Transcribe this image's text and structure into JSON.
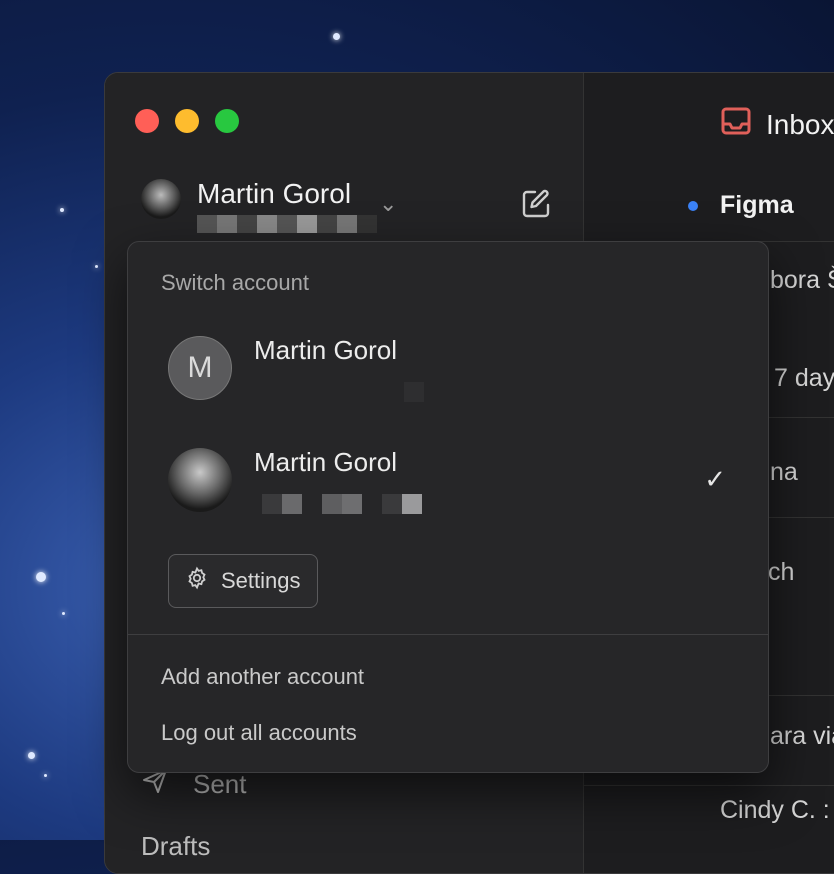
{
  "window": {
    "controls": [
      "close",
      "minimize",
      "zoom"
    ]
  },
  "sidebar": {
    "account_name": "Martin Gorol",
    "nav": [
      {
        "label": "Sent",
        "icon": "paper-plane-icon"
      },
      {
        "label": "Drafts",
        "icon": "drafts-icon"
      }
    ]
  },
  "mail_list": {
    "title": "Inbox",
    "rows": [
      {
        "sender": "Figma",
        "unread": true
      },
      {
        "sender": "bora Š"
      },
      {
        "sender": "7 day"
      },
      {
        "sender": "na"
      },
      {
        "sender": "ch"
      },
      {
        "sender": "ara via"
      },
      {
        "sender": "Cindy C. :"
      }
    ]
  },
  "switcher": {
    "title": "Switch account",
    "accounts": [
      {
        "name": "Martin Gorol",
        "initial": "M",
        "selected": false
      },
      {
        "name": "Martin Gorol",
        "initial": "",
        "selected": true
      }
    ],
    "check": "✓",
    "settings_label": "Settings",
    "add_account_label": "Add another account",
    "logout_label": "Log out all accounts"
  },
  "colors": {
    "accent_unread": "#3b82f6",
    "inbox_icon": "#e0605a"
  }
}
